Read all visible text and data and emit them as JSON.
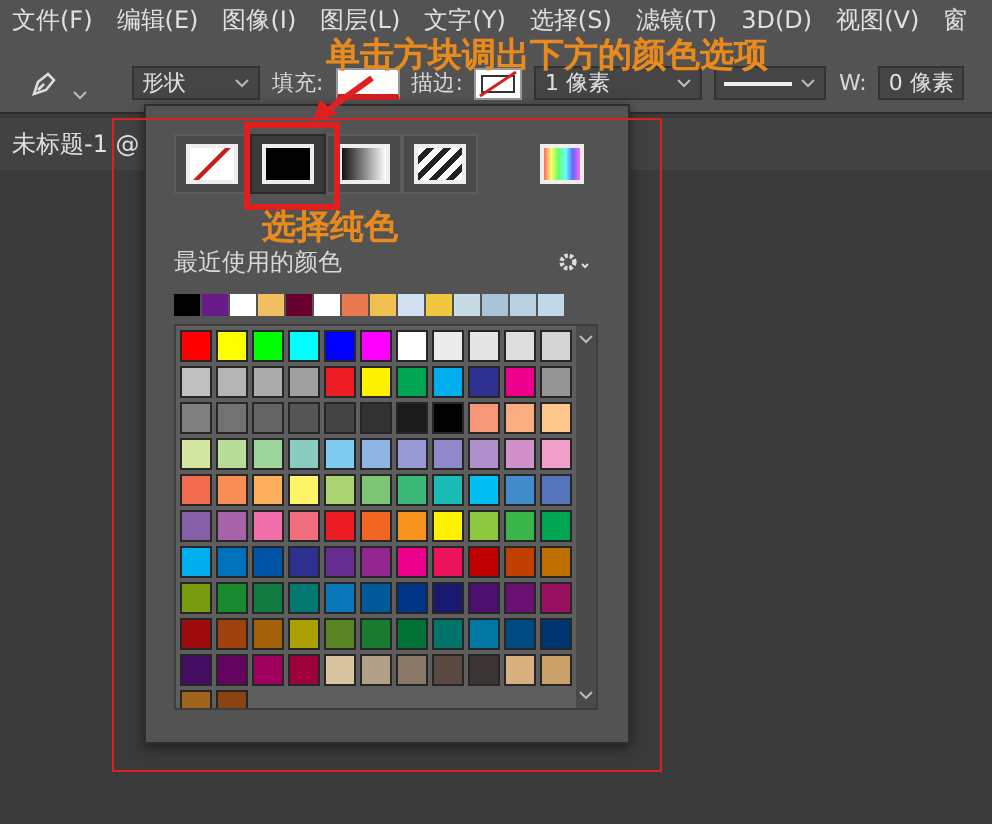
{
  "menu_bar": {
    "items": [
      "文件(F)",
      "编辑(E)",
      "图像(I)",
      "图层(L)",
      "文字(Y)",
      "选择(S)",
      "滤镜(T)",
      "3D(D)",
      "视图(V)",
      "窗"
    ]
  },
  "options_bar": {
    "shape_mode": "形状",
    "fill_label": "填充:",
    "stroke_label": "描边:",
    "stroke_width": "1 像素",
    "width_label": "W:",
    "width_value": "0 像素"
  },
  "document_tab": {
    "title": "未标题-1 @"
  },
  "color_panel": {
    "fill_types": [
      {
        "kind": "none",
        "selected": false
      },
      {
        "kind": "solid",
        "selected": true
      },
      {
        "kind": "gradient",
        "selected": false
      },
      {
        "kind": "pattern",
        "selected": false
      }
    ],
    "recent_label": "最近使用的颜色",
    "recent_colors": [
      {
        "color": "#000000"
      },
      {
        "color": "#6a1b8a"
      },
      {
        "color": "#ffffff"
      },
      {
        "color": "#f0c060"
      },
      {
        "color": "#6a0030"
      },
      {
        "color": "#ffffff"
      },
      {
        "color": "#e87850"
      },
      {
        "color": "#f0c050"
      },
      {
        "color": "#d0e0f0"
      },
      {
        "color": "#f0c840"
      },
      {
        "color": "#c8dce8"
      },
      {
        "color": "#a8c4d8"
      },
      {
        "color": "#b8d0e0"
      },
      {
        "color": "#c0d8e8"
      }
    ],
    "swatches": [
      {
        "color": "#ff0000"
      },
      {
        "color": "#ffff00"
      },
      {
        "color": "#00ff00"
      },
      {
        "color": "#00ffff"
      },
      {
        "color": "#0000ff"
      },
      {
        "color": "#ff00ff"
      },
      {
        "color": "#ffffff"
      },
      {
        "color": "#ebebeb"
      },
      {
        "color": "#e6e6e6"
      },
      {
        "color": "#dedede"
      },
      {
        "color": "#d6d6d6"
      },
      {
        "color": "#c0c0c0"
      },
      {
        "color": "#b4b4b4"
      },
      {
        "color": "#acacac"
      },
      {
        "color": "#a0a0a0"
      },
      {
        "color": "#ee1c24"
      },
      {
        "color": "#fff200"
      },
      {
        "color": "#00a651"
      },
      {
        "color": "#00aeef"
      },
      {
        "color": "#2e3192"
      },
      {
        "color": "#ec008c"
      },
      {
        "color": "#959595"
      },
      {
        "color": "#808080"
      },
      {
        "color": "#727272"
      },
      {
        "color": "#646464"
      },
      {
        "color": "#555555"
      },
      {
        "color": "#444444"
      },
      {
        "color": "#333333"
      },
      {
        "color": "#1a1a1a"
      },
      {
        "color": "#000000"
      },
      {
        "color": "#f7977a"
      },
      {
        "color": "#f9ad81"
      },
      {
        "color": "#fdc68a"
      },
      {
        "color": "#d4e6a0"
      },
      {
        "color": "#b8dc9a"
      },
      {
        "color": "#9cd49c"
      },
      {
        "color": "#88ccc0"
      },
      {
        "color": "#80ccf0"
      },
      {
        "color": "#90b4e4"
      },
      {
        "color": "#9898d4"
      },
      {
        "color": "#9088cc"
      },
      {
        "color": "#b090cc"
      },
      {
        "color": "#d090c8"
      },
      {
        "color": "#f0a0c8"
      },
      {
        "color": "#f26c4f"
      },
      {
        "color": "#f68e55"
      },
      {
        "color": "#fbaf5c"
      },
      {
        "color": "#fff467"
      },
      {
        "color": "#acd372"
      },
      {
        "color": "#7cc576"
      },
      {
        "color": "#3bb878"
      },
      {
        "color": "#1abbb4"
      },
      {
        "color": "#00bff3"
      },
      {
        "color": "#438ccb"
      },
      {
        "color": "#5574b9"
      },
      {
        "color": "#8560a8"
      },
      {
        "color": "#a763a8"
      },
      {
        "color": "#f06ea9"
      },
      {
        "color": "#f26d7d"
      },
      {
        "color": "#ed1c24"
      },
      {
        "color": "#f26522"
      },
      {
        "color": "#f7941d"
      },
      {
        "color": "#fff200"
      },
      {
        "color": "#8dc63f"
      },
      {
        "color": "#39b54a"
      },
      {
        "color": "#00a651"
      },
      {
        "color": "#00aeef"
      },
      {
        "color": "#0072bc"
      },
      {
        "color": "#0054a6"
      },
      {
        "color": "#2e3192"
      },
      {
        "color": "#662d91"
      },
      {
        "color": "#92278f"
      },
      {
        "color": "#ec008c"
      },
      {
        "color": "#ed145b"
      },
      {
        "color": "#c00000"
      },
      {
        "color": "#c04000"
      },
      {
        "color": "#c07000"
      },
      {
        "color": "#7a9a10"
      },
      {
        "color": "#198a30"
      },
      {
        "color": "#107a40"
      },
      {
        "color": "#007a70"
      },
      {
        "color": "#0a78b8"
      },
      {
        "color": "#005a9a"
      },
      {
        "color": "#003484"
      },
      {
        "color": "#1a1a70"
      },
      {
        "color": "#4b1070"
      },
      {
        "color": "#6a1070"
      },
      {
        "color": "#9a1060"
      },
      {
        "color": "#9e0b0f"
      },
      {
        "color": "#a0410d"
      },
      {
        "color": "#a3620a"
      },
      {
        "color": "#aba000"
      },
      {
        "color": "#598527"
      },
      {
        "color": "#1a7b30"
      },
      {
        "color": "#007236"
      },
      {
        "color": "#00746b"
      },
      {
        "color": "#0076a3"
      },
      {
        "color": "#004a80"
      },
      {
        "color": "#003471"
      },
      {
        "color": "#440e62"
      },
      {
        "color": "#630460"
      },
      {
        "color": "#9e005d"
      },
      {
        "color": "#9e0039"
      },
      {
        "color": "#d8c4a0"
      },
      {
        "color": "#b0a088"
      },
      {
        "color": "#8a7868"
      },
      {
        "color": "#5a4a42"
      },
      {
        "color": "#3a3533"
      },
      {
        "color": "#d8b080"
      },
      {
        "color": "#c8a068"
      },
      {
        "color": "#a0641c"
      },
      {
        "color": "#8a4414"
      }
    ]
  },
  "annotations": {
    "top_note": "单击方块调出下方的颜色选项",
    "solid_note": "选择纯色"
  }
}
